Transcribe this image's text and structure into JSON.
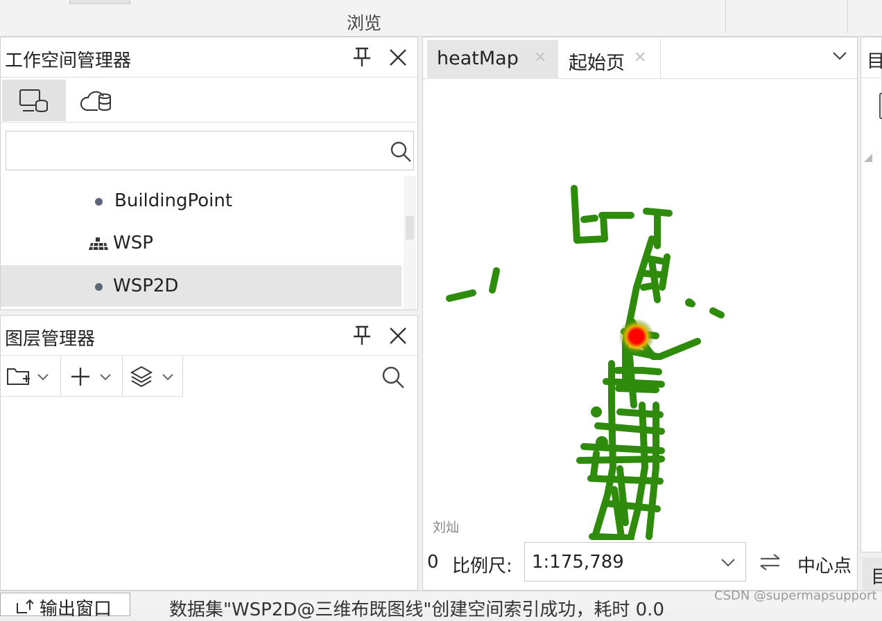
{
  "ribbon": {
    "group_label": "浏览"
  },
  "workspace_panel": {
    "title": "工作空间管理器",
    "pin_icon": "pin-icon",
    "close_icon": "close-icon",
    "tabs": [
      {
        "icon": "local-database-icon"
      },
      {
        "icon": "cloud-database-icon"
      }
    ],
    "search_placeholder": "",
    "items": [
      {
        "label": "BuildingPoint",
        "icon": "point-dataset-icon"
      },
      {
        "label": "WSP",
        "icon": "3d-model-dataset-icon"
      },
      {
        "label": "WSP2D",
        "icon": "point-dataset-icon",
        "selected": true
      }
    ]
  },
  "layer_panel": {
    "title": "图层管理器",
    "toolbar": [
      {
        "icon": "new-folder-icon"
      },
      {
        "icon": "add-icon"
      },
      {
        "icon": "layers-icon"
      }
    ],
    "search_placeholder": ""
  },
  "map_window": {
    "tabs": [
      {
        "label": "heatMap",
        "active": true
      },
      {
        "label": "起始页",
        "active": false
      }
    ],
    "watermark": "刘灿",
    "status": {
      "left_value": "0",
      "scale_label": "比例尺:",
      "scale_value": "1:175,789",
      "center_label": "中心点"
    }
  },
  "right_panel": {
    "title_partial": "目",
    "bottom_partial": "目"
  },
  "bottom_bar": {
    "output_tab_label": "输出窗口",
    "message": "数据集\"WSP2D@三维布既图线\"创建空间索引成功，耗时 0.0"
  },
  "source_watermark": "CSDN @supermapsupport",
  "colors": {
    "route": "#2e8b0c",
    "hotspot": "#ff0000",
    "selection": "#e5e5e5"
  }
}
